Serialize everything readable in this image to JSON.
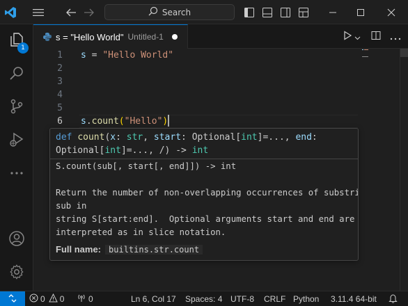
{
  "titlebar": {
    "search_label": "Search",
    "vscode_icon": "vscode-logo-icon",
    "menu_icon": "hamburger-menu-icon",
    "back_icon": "arrow-left-icon",
    "forward_icon": "arrow-right-icon"
  },
  "activitybar": {
    "items": [
      {
        "name": "explorer",
        "icon": "files-icon",
        "badge": "1"
      },
      {
        "name": "search",
        "icon": "search-icon"
      },
      {
        "name": "source-control",
        "icon": "source-control-icon"
      },
      {
        "name": "run-debug",
        "icon": "run-debug-icon"
      },
      {
        "name": "more",
        "icon": "ellipsis-icon"
      },
      {
        "name": "accounts",
        "icon": "account-icon"
      },
      {
        "name": "manage",
        "icon": "gear-icon"
      }
    ]
  },
  "tab": {
    "title": "s = \"Hello World\"",
    "description": "Untitled-1",
    "dirty": true
  },
  "editor": {
    "line_numbers": [
      "1",
      "2",
      "3",
      "4",
      "5",
      "6"
    ],
    "active_line": 6,
    "line1": {
      "var": "s",
      "op": " = ",
      "str": "\"Hello World\""
    },
    "line6": {
      "obj": "s",
      "dot": ".",
      "fn": "count",
      "open": "(",
      "arg": "\"Hello\"",
      "close": ")"
    }
  },
  "hover": {
    "signature": {
      "kw": "def",
      "fn": "count",
      "p1": "x",
      "t1": "str",
      "p2": "start",
      "t2a": "Optional",
      "t2b": "int",
      "p3": "end",
      "t3a": "Optional",
      "t3b": "int",
      "ret": "int"
    },
    "doc_lines": [
      "S.count(sub[, start[, end]]) -> int",
      "",
      "Return the number of non-overlapping occurrences of substring",
      "sub in",
      "string S[start:end].  Optional arguments start and end are",
      "interpreted as in slice notation."
    ],
    "fullname_label": "Full name:",
    "fullname_value": "builtins.str.count"
  },
  "statusbar": {
    "errors": "0",
    "warnings": "0",
    "ports": "0",
    "position": "Ln 6, Col 17",
    "spaces": "Spaces: 4",
    "encoding": "UTF-8",
    "eol": "CRLF",
    "language": "Python",
    "interpreter": "3.11.4 64-bit"
  },
  "colors": {
    "accent": "#0078d4",
    "string": "#ce9178",
    "function": "#dcdcaa",
    "variable": "#9cdcfe",
    "keyword": "#569cd6",
    "type": "#4ec9b0",
    "bracket": "#ffd700"
  }
}
